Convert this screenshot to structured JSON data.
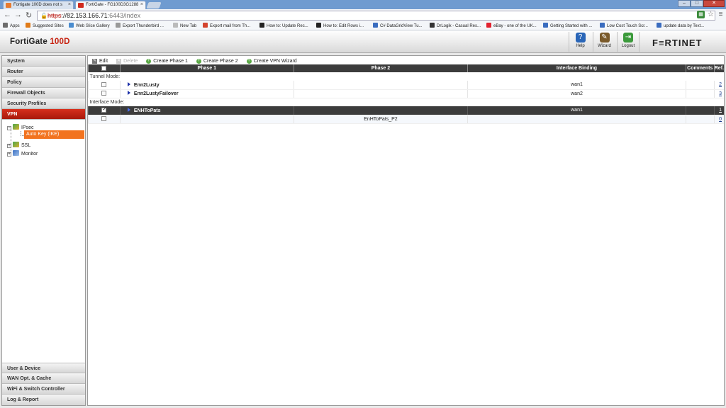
{
  "browser": {
    "tabs": [
      {
        "title": "Fortigate 100D does not s"
      },
      {
        "title": "FortiGate - FG100D3G1288"
      }
    ],
    "address": {
      "scheme": "https",
      "host": "82.153.166.71",
      "path": ":6443/index"
    },
    "bookmarks": [
      {
        "label": "Apps",
        "color": "#6d6d6d"
      },
      {
        "label": "Suggested Sites",
        "color": "#e07b19"
      },
      {
        "label": "Web Slice Gallery",
        "color": "#4a8ccf"
      },
      {
        "label": "Export Thunderbird ...",
        "color": "#999999"
      },
      {
        "label": "New Tab",
        "color": "#bbbbbb"
      },
      {
        "label": "Export mail from Th...",
        "color": "#d4442f"
      },
      {
        "label": "How to: Update Rec...",
        "color": "#222222"
      },
      {
        "label": "How to: Edit Rows i...",
        "color": "#222222"
      },
      {
        "label": "C# DataGridView Tu...",
        "color": "#3a6cbf"
      },
      {
        "label": "DrLogik - Casual Res...",
        "color": "#333333"
      },
      {
        "label": "eBay - one of the UK...",
        "color": "#e2222f"
      },
      {
        "label": "Getting Started with ...",
        "color": "#3a6cbf"
      },
      {
        "label": "Low Cost Touch Scr...",
        "color": "#3a6cbf"
      },
      {
        "label": "update data by Text...",
        "color": "#3a6cbf"
      }
    ]
  },
  "header": {
    "product": "FortiGate",
    "model": "100D",
    "brand": "F≡RTINET",
    "buttons": [
      {
        "label": "Help",
        "icon": "help-icon",
        "color": "#2a66b8"
      },
      {
        "label": "Wizard",
        "icon": "wizard-icon",
        "color": "#7a5a2a"
      },
      {
        "label": "Logout",
        "icon": "logout-icon",
        "color": "#3b9a3b"
      }
    ]
  },
  "nav": {
    "top_sections": [
      "System",
      "Router",
      "Policy",
      "Firewall Objects",
      "Security Profiles"
    ],
    "active_section": "VPN",
    "tree": {
      "ipsec": "IPsec",
      "auto_key": "Auto Key (IKE)",
      "ssl": "SSL",
      "monitor": "Monitor"
    },
    "bottom_sections": [
      "User & Device",
      "WAN Opt. & Cache",
      "WiFi & Switch Controller",
      "Log & Report"
    ]
  },
  "toolbar": {
    "edit": "Edit",
    "delete": "Delete",
    "create_phase1": "Create Phase 1",
    "create_phase2": "Create Phase 2",
    "create_wizard": "Create VPN Wizard"
  },
  "table": {
    "headers": {
      "phase1": "Phase 1",
      "phase2": "Phase 2",
      "binding": "Interface Binding",
      "comments": "Comments",
      "ref": "Ref."
    },
    "tunnel_mode_label": "Tunnel Mode:",
    "interface_mode_label": "Interface Mode:",
    "tunnel_rows": [
      {
        "phase1": "Enn2Lusty",
        "phase2": "",
        "binding": "wan1",
        "comments": "",
        "ref": "2"
      },
      {
        "phase1": "Enn2LustyFailover",
        "phase2": "",
        "binding": "wan2",
        "comments": "",
        "ref": "3"
      }
    ],
    "interface_rows": [
      {
        "phase1": "ENHToPats",
        "phase2": "",
        "binding": "wan1",
        "comments": "",
        "ref": "1",
        "checked": true
      },
      {
        "phase1": "",
        "phase2": "EnHToPats_P2",
        "binding": "",
        "comments": "",
        "ref": "0",
        "checked": false
      }
    ]
  }
}
